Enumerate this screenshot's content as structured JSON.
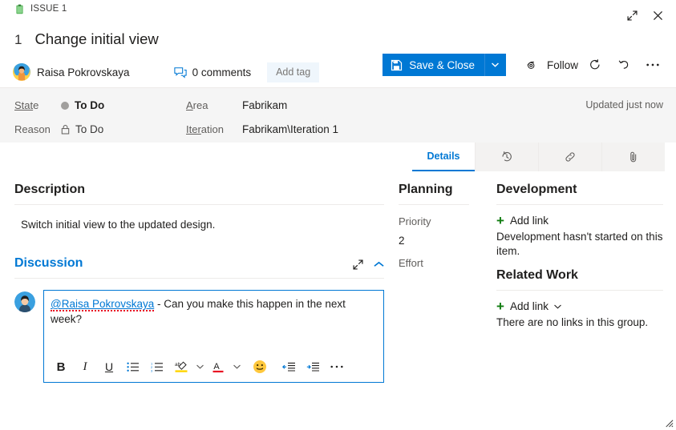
{
  "window": {
    "work_item_type": "ISSUE 1",
    "type_icon": "issue-clipboard-icon",
    "expand_icon": "expand-icon",
    "close_icon": "close-icon",
    "resize_grip": "resize-grip-icon",
    "accent_color": "#339947"
  },
  "header": {
    "id": "1",
    "title": "Change initial view",
    "author": "Raisa Pokrovskaya",
    "avatar_icon": "user-avatar",
    "comments_label": "0 comments",
    "comments_icon": "comment-bubble-icon",
    "add_tag_label": "Add tag"
  },
  "commands": {
    "save_label": "Save & Close",
    "save_icon": "save-floppy-icon",
    "save_dropdown_icon": "chevron-down-icon",
    "follow_label": "Follow",
    "follow_icon": "eye-icon",
    "refresh_icon": "refresh-icon",
    "undo_icon": "undo-icon",
    "more_icon": "more-ellipsis-icon",
    "accent_color": "#0078d4"
  },
  "fields": {
    "state": {
      "label": "State",
      "value": "To Do",
      "icon": "state-dot-icon",
      "dot_color": "#a19f9d"
    },
    "reason": {
      "label": "Reason",
      "value": "To Do",
      "icon": "lock-icon"
    },
    "area": {
      "label": "Area",
      "value": "Fabrikam"
    },
    "iteration": {
      "label": "Iteration",
      "value": "Fabrikam\\Iteration 1"
    },
    "updated": "Updated just now"
  },
  "tabs": [
    {
      "label": "Details",
      "icon": "",
      "active": true
    },
    {
      "label": "",
      "icon": "history-icon",
      "active": false
    },
    {
      "label": "",
      "icon": "link-icon",
      "active": false
    },
    {
      "label": "",
      "icon": "attachment-paperclip-icon",
      "active": false
    }
  ],
  "description": {
    "title": "Description",
    "text": "Switch initial view to the updated design."
  },
  "discussion": {
    "title": "Discussion",
    "expand_icon": "expand-icon",
    "collapse_icon": "chevron-up-icon",
    "avatar_icon": "user-avatar",
    "comment_mention": "@Raisa Pokrovskaya",
    "comment_rest": " - Can you make this happen in the next week?",
    "toolbar": [
      {
        "name": "bold-icon",
        "glyph": "B"
      },
      {
        "name": "italic-icon",
        "glyph": "I"
      },
      {
        "name": "underline-icon",
        "glyph": "U"
      },
      {
        "name": "bulleted-list-icon",
        "glyph": ""
      },
      {
        "name": "numbered-list-icon",
        "glyph": ""
      },
      {
        "name": "highlight-color-icon",
        "glyph": ""
      },
      {
        "name": "font-color-icon",
        "glyph": ""
      },
      {
        "name": "emoji-icon",
        "glyph": ""
      },
      {
        "name": "decrease-indent-icon",
        "glyph": ""
      },
      {
        "name": "increase-indent-icon",
        "glyph": ""
      },
      {
        "name": "more-formatting-icon",
        "glyph": ""
      }
    ]
  },
  "planning": {
    "title": "Planning",
    "priority_label": "Priority",
    "priority_value": "2",
    "effort_label": "Effort",
    "effort_value": ""
  },
  "development": {
    "title": "Development",
    "add_link_label": "Add link",
    "empty_text": "Development hasn't started on this item."
  },
  "related_work": {
    "title": "Related Work",
    "add_link_label": "Add link",
    "dropdown_icon": "chevron-down-icon",
    "empty_text": "There are no links in this group."
  }
}
